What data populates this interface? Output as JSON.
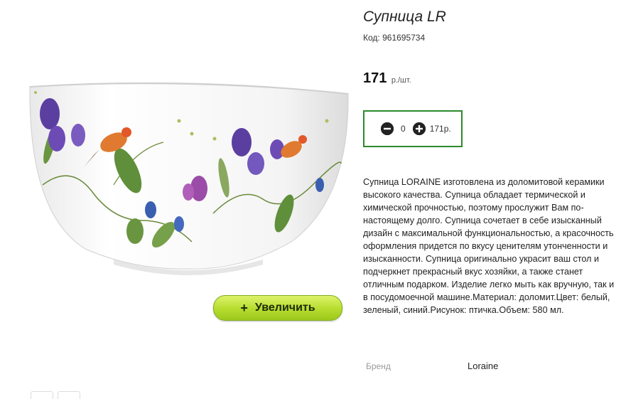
{
  "product": {
    "title": "Супница LR",
    "sku_label": "Код:",
    "sku": "961695734",
    "price": "171",
    "price_unit": "р./шт.",
    "image_alt": "bowl-with-birds-and-flowers"
  },
  "image": {
    "zoom_label": "Увеличить",
    "zoom_icon": "+"
  },
  "cart": {
    "minus_icon": "minus-circle-icon",
    "plus_icon": "plus-circle-icon",
    "quantity": "0",
    "total": "171р."
  },
  "description": "Супница LORAINE изготовлена из доломитовой керамики высокого качества. Супница обладает термической и химической прочностью, поэтому прослужит Вам по-настоящему долго. Супница сочетает в себе изысканный дизайн с максимальной функциональностью, а красочность оформления придется по вкусу ценителям утонченности и изысканности. Супница оригинально украсит ваш стол и подчеркнет прекрасный вкус хозяйки, а также станет отличным подарком. Изделие легко мыть как вручную, так и в посудомоечной машине.Материал: доломит.Цвет: белый, зеленый, синий.Рисунок: птичка.Объем: 580 мл.",
  "specs": {
    "brand_label": "Бренд",
    "brand_value": "Loraine"
  },
  "colors": {
    "cart_border": "#2b8a2b",
    "zoom_button": "#b6dc2e"
  }
}
